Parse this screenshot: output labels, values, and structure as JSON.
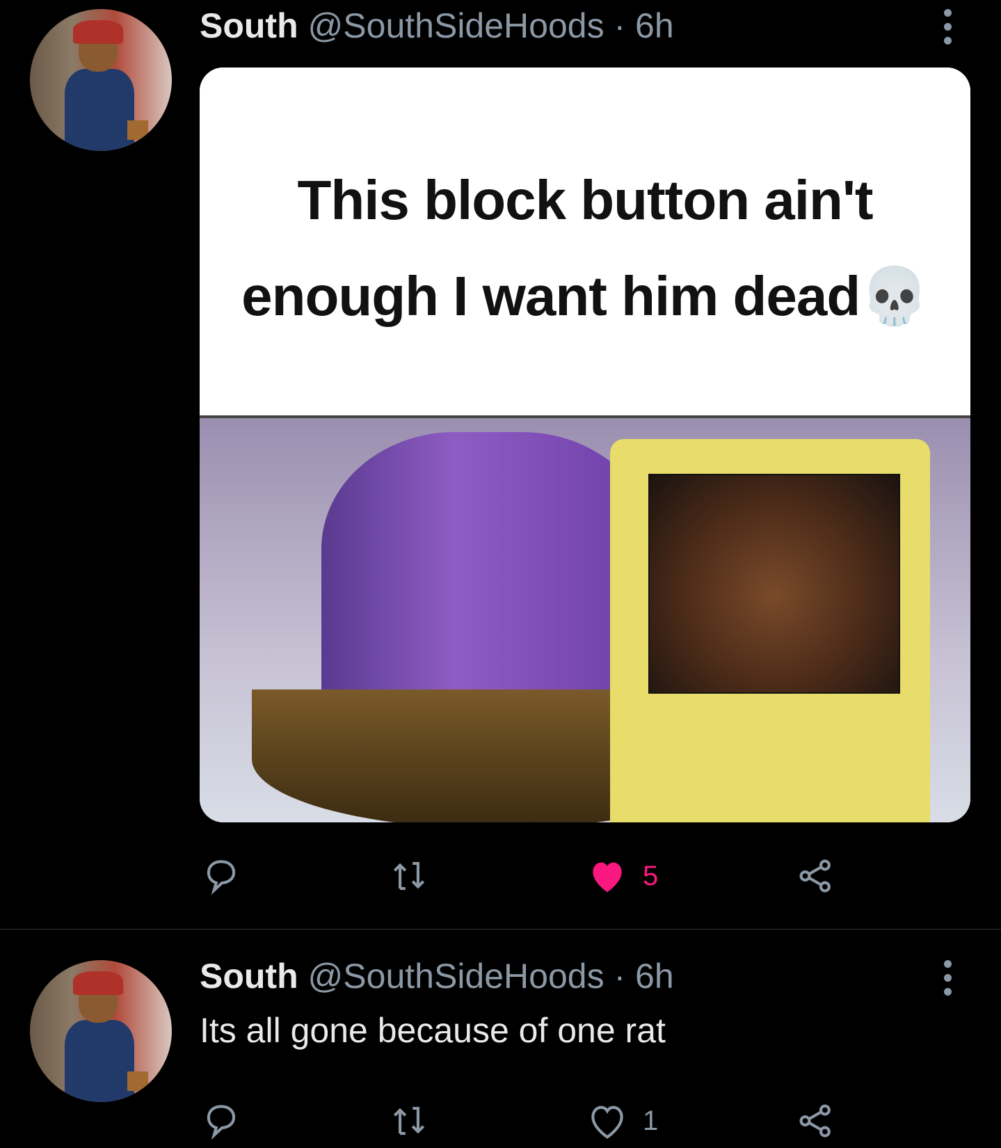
{
  "tweets": [
    {
      "name": "South",
      "handle": "@SouthSideHoods",
      "time": "· 6h",
      "media_caption": "This block button ain't enough I want him dead💀",
      "likes": "5",
      "liked": true
    },
    {
      "name": "South",
      "handle": "@SouthSideHoods",
      "time": "· 6h",
      "text": "Its all gone because of one rat",
      "likes": "1",
      "liked": false
    }
  ],
  "colors": {
    "like_active": "#f91880",
    "icon_gray": "#8b98a5",
    "background": "#000000"
  },
  "icons": [
    "reply-icon",
    "retweet-icon",
    "heart-icon",
    "share-icon",
    "more-icon"
  ]
}
